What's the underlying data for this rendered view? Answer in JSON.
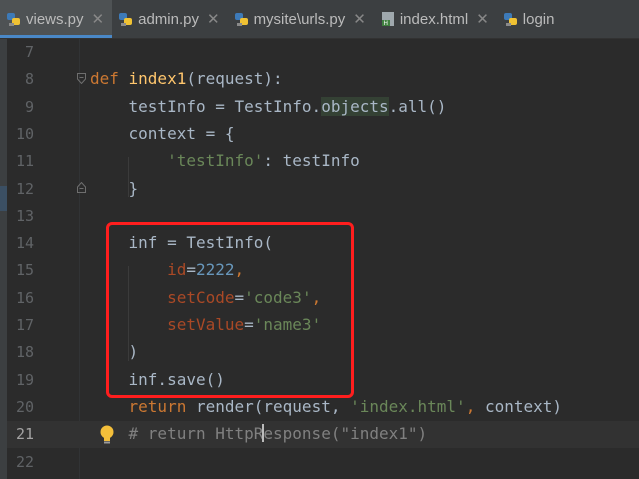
{
  "tabs": [
    {
      "label": "views.py",
      "icon": "python-file-icon",
      "active": true
    },
    {
      "label": "admin.py",
      "icon": "python-file-icon"
    },
    {
      "label": "mysite\\urls.py",
      "icon": "python-file-icon"
    },
    {
      "label": "index.html",
      "icon": "html-file-icon"
    },
    {
      "label": "login",
      "icon": "python-file-icon"
    }
  ],
  "close_glyph": "✕",
  "lines": [
    {
      "num": "7"
    },
    {
      "num": "8",
      "tokens": [
        [
          "kw",
          "def "
        ],
        [
          "fn",
          "index1"
        ],
        [
          "",
          "(request):"
        ]
      ]
    },
    {
      "num": "9",
      "tokens": [
        [
          "",
          "    testInfo = TestInfo."
        ],
        [
          "hl",
          "objects"
        ],
        [
          "",
          ".all()"
        ]
      ]
    },
    {
      "num": "10",
      "tokens": [
        [
          "",
          "    context = {"
        ]
      ]
    },
    {
      "num": "11",
      "tokens": [
        [
          "",
          "        "
        ],
        [
          "str",
          "'testInfo'"
        ],
        [
          "",
          ": testInfo"
        ]
      ]
    },
    {
      "num": "12",
      "tokens": [
        [
          "",
          "    }"
        ]
      ]
    },
    {
      "num": "13"
    },
    {
      "num": "14",
      "tokens": [
        [
          "",
          "    inf = TestInfo("
        ]
      ]
    },
    {
      "num": "15",
      "tokens": [
        [
          "",
          "        "
        ],
        [
          "param",
          "id"
        ],
        [
          "",
          "="
        ],
        [
          "num",
          "2222"
        ],
        [
          "kw",
          ","
        ]
      ]
    },
    {
      "num": "16",
      "tokens": [
        [
          "",
          "        "
        ],
        [
          "param",
          "setCode"
        ],
        [
          "",
          "="
        ],
        [
          "str",
          "'code3'"
        ],
        [
          "kw",
          ","
        ]
      ]
    },
    {
      "num": "17",
      "tokens": [
        [
          "",
          "        "
        ],
        [
          "param",
          "setValue"
        ],
        [
          "",
          "="
        ],
        [
          "str",
          "'name3'"
        ]
      ]
    },
    {
      "num": "18",
      "tokens": [
        [
          "",
          "    )"
        ]
      ]
    },
    {
      "num": "19",
      "tokens": [
        [
          "",
          "    inf.save()"
        ]
      ]
    },
    {
      "num": "20",
      "tokens": [
        [
          "",
          "    "
        ],
        [
          "kw",
          "return "
        ],
        [
          "",
          "render(request, "
        ],
        [
          "str",
          "'index.html'"
        ],
        [
          "kw",
          ", "
        ],
        [
          "",
          "context)"
        ]
      ]
    },
    {
      "num": "21",
      "current": true,
      "tokens": [
        [
          "cmt",
          "    # return HttpR"
        ],
        [
          "caret",
          ""
        ],
        [
          "cmt",
          "esponse(\"index1\")"
        ]
      ]
    },
    {
      "num": "22"
    }
  ],
  "colors": {
    "background": "#2b2b2b",
    "keyword": "#cc7832",
    "function": "#ffc66d",
    "string": "#6a8759",
    "number": "#6897bb",
    "parameter": "#aa4926",
    "comment": "#808080",
    "highlight_box": "#ff1e1e"
  }
}
